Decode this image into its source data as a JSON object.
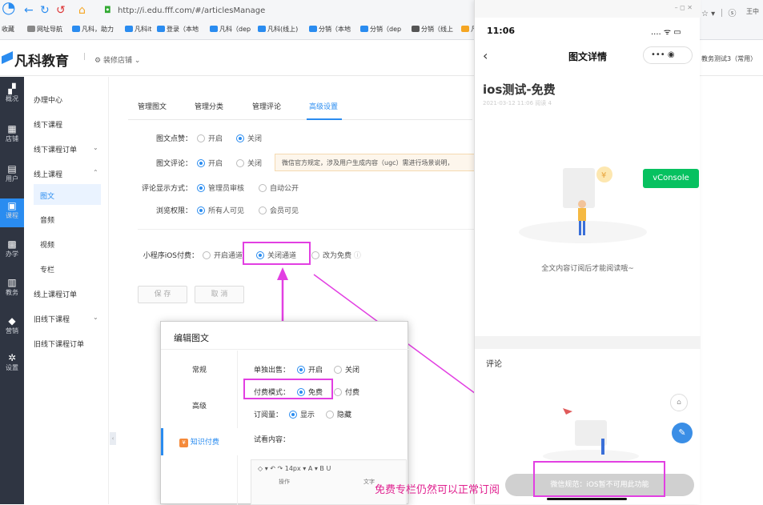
{
  "browser": {
    "url": "http://i.edu.fff.com/#/articlesManage",
    "user": "王中",
    "bookmarks": [
      "收藏",
      "网址导航",
      "凡科，助力",
      "凡科it",
      "登录（本地",
      "凡科（dep",
      "凡科(线上)",
      "分销（本地",
      "分销（dep",
      "分销（线上",
      "凡"
    ]
  },
  "brand": {
    "name": "凡科教育",
    "store_link": "装修店铺",
    "right_user": "教务测试3（常用）"
  },
  "dark_sidebar": [
    {
      "label": "概况",
      "icon": "chart-icon"
    },
    {
      "label": "店铺",
      "icon": "store-icon"
    },
    {
      "label": "用户",
      "icon": "user-icon"
    },
    {
      "label": "课程",
      "icon": "course-icon"
    },
    {
      "label": "办学",
      "icon": "school-icon"
    },
    {
      "label": "教务",
      "icon": "calendar-icon"
    },
    {
      "label": "营销",
      "icon": "tag-icon"
    },
    {
      "label": "设置",
      "icon": "gear-icon"
    }
  ],
  "menu": {
    "items": [
      "办理中心",
      "线下课程",
      "线下课程订单",
      "线上课程",
      "图文",
      "音频",
      "视频",
      "专栏",
      "线上课程订单",
      "旧线下课程",
      "旧线下课程订单"
    ]
  },
  "tabs": [
    "管理图文",
    "管理分类",
    "管理评论",
    "高级设置"
  ],
  "settings": {
    "like": {
      "label": "图文点赞：",
      "opt1": "开启",
      "opt2": "关闭"
    },
    "comment": {
      "label": "图文评论：",
      "opt1": "开启",
      "opt2": "关闭",
      "tip": "微信官方规定，涉及用户生成内容（ugc）需进行场景说明，"
    },
    "display": {
      "label": "评论显示方式：",
      "opt1": "管理员审核",
      "opt2": "自动公开"
    },
    "perm": {
      "label": "浏览权限：",
      "opt1": "所有人可见",
      "opt2": "会员可见"
    },
    "ios": {
      "label": "小程序iOS付费：",
      "opt1": "开启通道",
      "opt2": "关闭通道",
      "opt3": "改为免费"
    },
    "save": "保 存",
    "cancel": "取 消"
  },
  "phone": {
    "time": "11:06",
    "status_icons": ".... ᯤ ▭",
    "nav_title": "图文详情",
    "capsule": "••• ◉",
    "title": "ios测试-免费",
    "meta": "2021-03-12 11:06  阅读 4",
    "locked": "全文内容订阅后才能阅读哦~",
    "comment": "评论",
    "bottom_btn": "微信规范：iOS暂不可用此功能"
  },
  "vconsole": "vConsole",
  "dialog": {
    "title": "编辑图文",
    "nav": [
      "常规",
      "高级",
      "知识付费"
    ],
    "sell_label": "单独出售：",
    "sell_on": "开启",
    "sell_off": "关闭",
    "pay_label": "付费模式：",
    "pay_free": "免费",
    "pay_paid": "付费",
    "sub_label": "订阅量：",
    "sub_show": "显示",
    "sub_hide": "隐藏",
    "trial_label": "试看内容：",
    "toolbar": "◇ ▾ ↶ ↷  14px ▾  A ▾  B  U",
    "toolbar_sub1": "操作",
    "toolbar_sub2": "文字"
  },
  "caption": "免费专栏仍然可以正常订阅",
  "colors": {
    "accent": "#2a8cf0",
    "highlight": "#e23fe2",
    "green": "#07c160"
  }
}
